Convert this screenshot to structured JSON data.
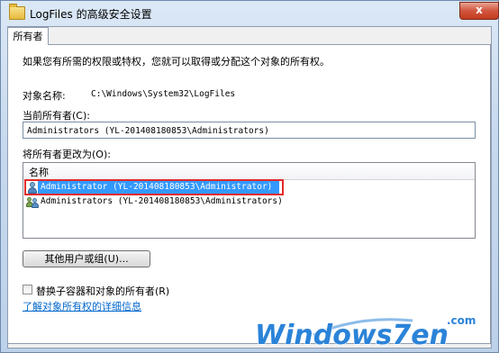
{
  "window": {
    "title": "LogFiles 的高级安全设置",
    "close_glyph": "x"
  },
  "tabs": [
    "所有者"
  ],
  "owner_tab": {
    "intro": "如果您有所需的权限或特权，您就可以取得或分配这个对象的所有权。",
    "object_name_label": "对象名称:",
    "object_name_value": "C:\\Windows\\System32\\LogFiles",
    "current_owner_label": "当前所有者(C):",
    "current_owner_value": "Administrators (YL-201408180853\\Administrators)",
    "change_owner_label": "将所有者更改为(O):",
    "list": {
      "column_header": "名称",
      "items": [
        {
          "label": "Administrator (YL-201408180853\\Administrator)",
          "icon": "user-icon",
          "selected": true
        },
        {
          "label": "Administrators (YL-201408180853\\Administrators)",
          "icon": "group-icon",
          "selected": false
        }
      ]
    },
    "other_users_button": "其他用户或组(U)...",
    "replace_checkbox_label": "替换子容器和对象的所有者(R)",
    "replace_checked": false,
    "help_link": "了解对象所有权的详细信息"
  },
  "watermark": {
    "brand": "Windows7en",
    "suffix": ".com"
  },
  "colors": {
    "selection": "#3399ff",
    "highlight_border": "#e22a2a",
    "link": "#0066cc"
  }
}
